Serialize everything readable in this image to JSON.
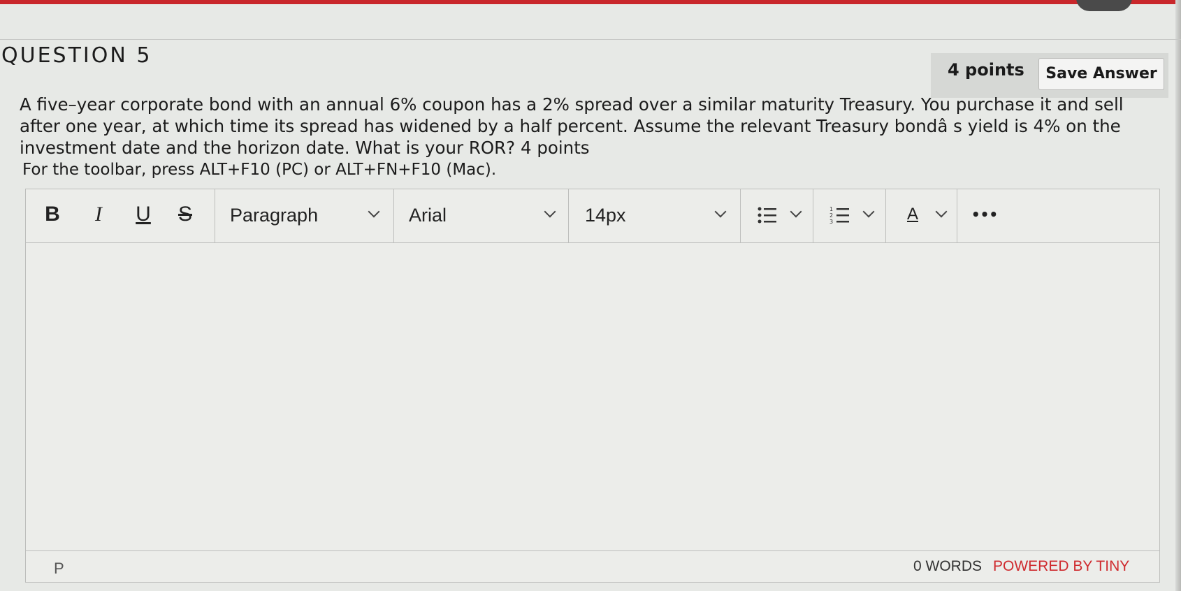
{
  "question": {
    "title": "QUESTION 5",
    "points": "4 points",
    "save_label": "Save Answer",
    "text": "A five–year corporate bond with an annual 6% coupon has a 2% spread over a similar maturity Treasury. You purchase it and sell after one year, at which time its spread has widened by a half percent. Assume the relevant Treasury bondâ s yield is 4% on the investment date and the horizon date. What is your ROR? 4 points",
    "toolbar_hint": "For the toolbar, press ALT+F10 (PC) or ALT+FN+F10 (Mac)."
  },
  "editor": {
    "toolbar": {
      "bold": "B",
      "italic": "I",
      "underline": "U",
      "strikethrough": "S",
      "block_format": "Paragraph",
      "font_family": "Arial",
      "font_size": "14px",
      "text_color": "A",
      "more": "•••"
    },
    "content": "",
    "status": {
      "path": "P",
      "word_count": "0 WORDS",
      "powered_by": "POWERED BY TINY"
    }
  },
  "colors": {
    "brand_red": "#cf2b2f",
    "background": "#e7e9e6"
  },
  "icons": [
    "bullet-list-icon",
    "numbered-list-icon",
    "chevron-down-icon",
    "more-icon"
  ]
}
